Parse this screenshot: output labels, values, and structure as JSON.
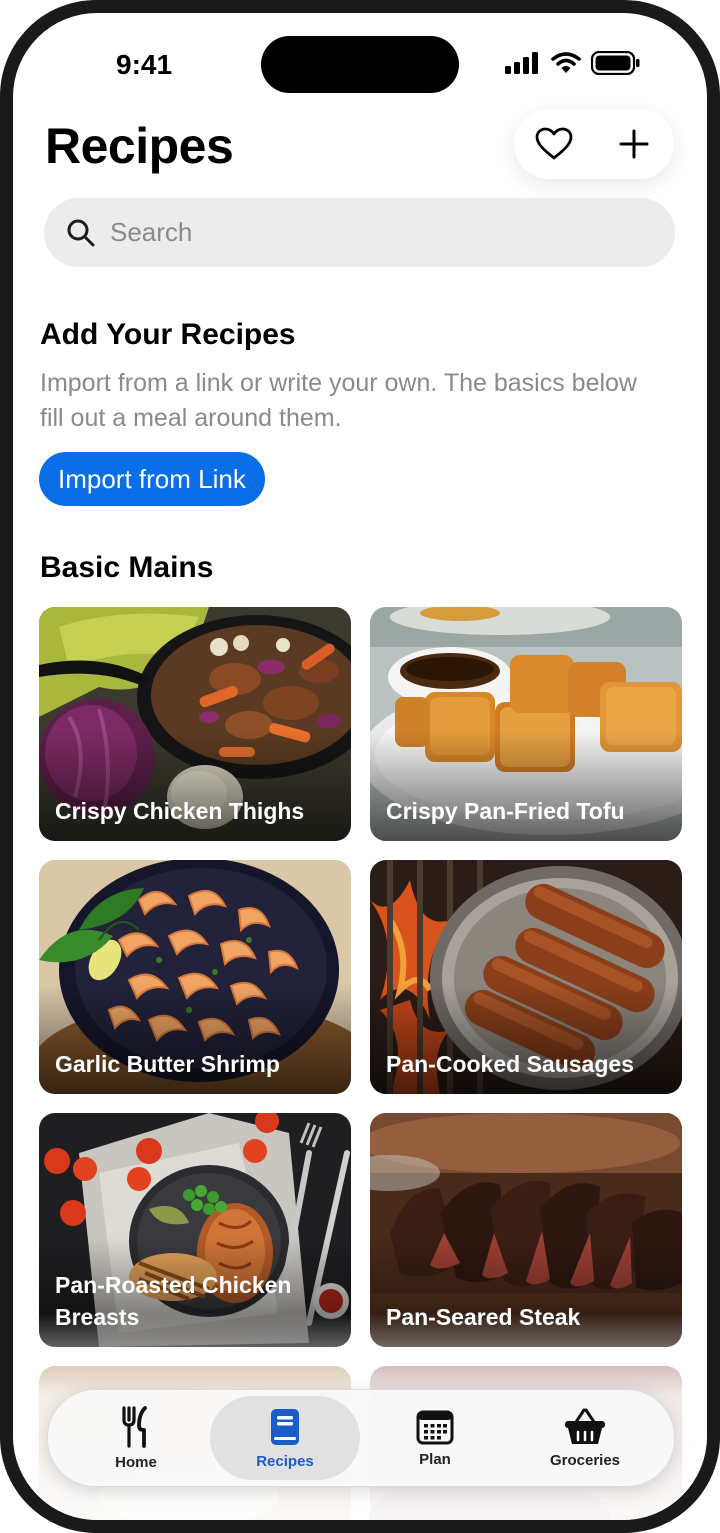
{
  "status_bar": {
    "time": "9:41"
  },
  "header": {
    "title": "Recipes"
  },
  "search": {
    "placeholder": "Search"
  },
  "add_section": {
    "title": "Add Your Recipes",
    "description": "Import from a link or write your own. The basics below fill out a meal around them.",
    "import_button": "Import from Link"
  },
  "basics": {
    "title": "Basic Mains",
    "cards": [
      {
        "label": "Crispy Chicken Thighs"
      },
      {
        "label": "Crispy Pan-Fried Tofu"
      },
      {
        "label": "Garlic Butter Shrimp"
      },
      {
        "label": "Pan-Cooked Sausages"
      },
      {
        "label": "Pan-Roasted Chicken Breasts"
      },
      {
        "label": "Pan-Seared Steak"
      }
    ]
  },
  "tabs": [
    {
      "label": "Home",
      "icon": "fork-knife-icon"
    },
    {
      "label": "Recipes",
      "icon": "book-icon"
    },
    {
      "label": "Plan",
      "icon": "calendar-icon"
    },
    {
      "label": "Groceries",
      "icon": "basket-icon"
    }
  ],
  "colors": {
    "accent": "#0a6ee6",
    "active_tab": "#1a5cc8"
  }
}
